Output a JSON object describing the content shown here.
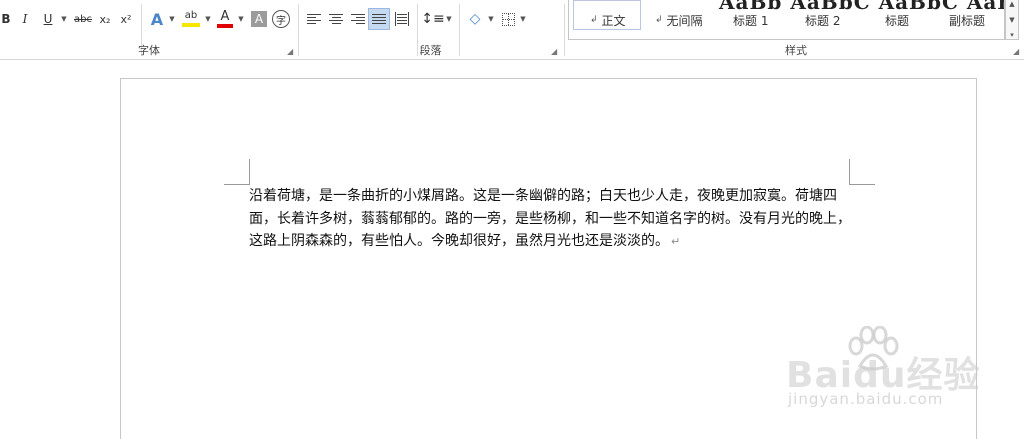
{
  "ribbon": {
    "font_group": {
      "label": "字体",
      "bold": "B",
      "italic": "I",
      "underline": "U",
      "strikethrough": "abc",
      "subscript": "x₂",
      "superscript": "x²",
      "text_effects": "A",
      "highlight": "ab",
      "font_color": "A",
      "char_shading": "A",
      "enclose_char": "字",
      "colors": {
        "highlight": "#f7e700",
        "font_color": "#e00000"
      }
    },
    "paragraph_group": {
      "label": "段落"
    },
    "styles_group": {
      "label": "样式",
      "preview_strip": "AaBb  AaBbC  AaBbC  AaBbC",
      "items": [
        {
          "label": "正文",
          "mark": "↲",
          "selected": true
        },
        {
          "label": "无间隔",
          "mark": "↲",
          "selected": false
        },
        {
          "label": "标题 1",
          "mark": "",
          "selected": false
        },
        {
          "label": "标题 2",
          "mark": "",
          "selected": false
        },
        {
          "label": "标题",
          "mark": "",
          "selected": false
        },
        {
          "label": "副标题",
          "mark": "",
          "selected": false
        }
      ]
    }
  },
  "document": {
    "paragraph": "沿着荷塘，是一条曲折的小煤屑路。这是一条幽僻的路；白天也少人走，夜晚更加寂寞。荷塘四面，长着许多树，蓊蓊郁郁的。路的一旁，是些杨柳，和一些不知道名字的树。没有月光的晚上，这路上阴森森的，有些怕人。今晚却很好，虽然月光也还是淡淡的。",
    "paragraph_mark": "↵"
  },
  "watermark": {
    "main": "Baidu经验",
    "sub": "jingyan.baidu.com"
  }
}
